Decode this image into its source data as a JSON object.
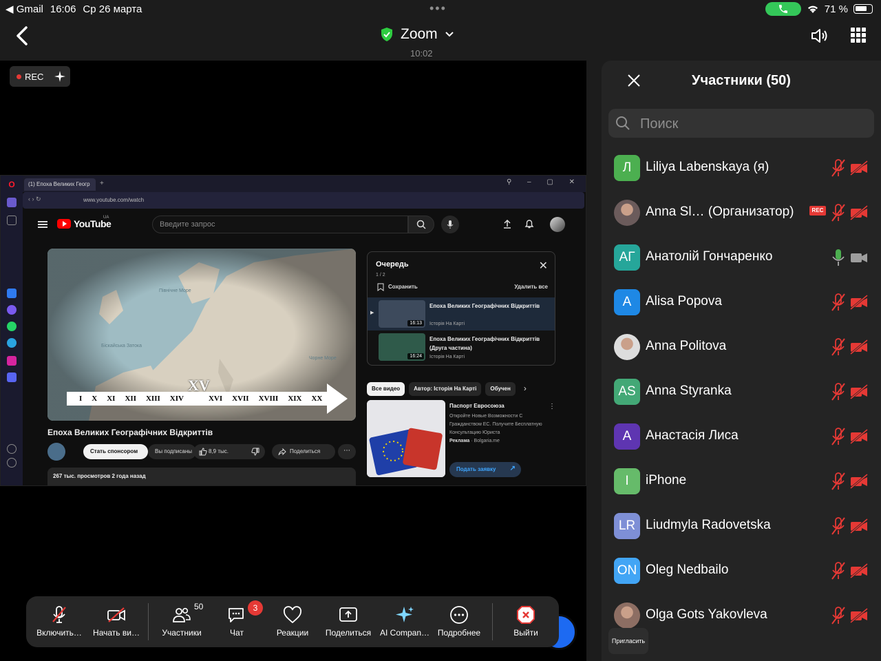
{
  "status_bar": {
    "back_app": "◀ Gmail",
    "time": "16:06",
    "date": "Ср 26 марта",
    "battery": "71 %",
    "colors": {
      "call": "#34c759"
    }
  },
  "header": {
    "title": "Zoom",
    "meeting_time": "10:02",
    "icons": [
      "chevron-left-icon",
      "shield-check-icon",
      "chevron-down-icon",
      "speaker-icon",
      "grid-icon"
    ]
  },
  "recording": {
    "label": "REC"
  },
  "shared_screen": {
    "tab_title": "(1) Епоха Великих Геогр",
    "url": "www.youtube.com/watch",
    "youtube": {
      "logo": "YouTube",
      "region": "UA",
      "search_placeholder": "Введите запрос",
      "video_title": "Епоха Великих Географічних Відкриттів",
      "sponsor_label": "Стать спонсором",
      "subscribed_label": "Вы подписаны",
      "likes": "8,9 тыс.",
      "share_label": "Поделиться",
      "views_info": "267 тыс. просмотров  2 года назад",
      "timeline_xv": "XV",
      "timeline_labels": [
        "I",
        "X",
        "XI",
        "XII",
        "XIII",
        "XIV",
        "XVI",
        "XVII",
        "XVIII",
        "XIX",
        "XX"
      ],
      "map_labels": {
        "north": "Північне Море",
        "biscay": "Біскайська Затока",
        "black": "Чорне Море"
      },
      "queue": {
        "title": "Очередь",
        "count": "1 / 2",
        "save": "Сохранить",
        "clear": "Удалить все",
        "items": [
          {
            "title": "Епоха Великих Географічних Відкриттів",
            "channel": "Історія На Карті",
            "duration": "16:13"
          },
          {
            "title": "Епоха Великих Географічних Відкриттів (Друга частина)",
            "channel": "Історія На Карті",
            "duration": "16:24"
          }
        ]
      },
      "chips": [
        "Все видео",
        "Автор: Історія На Карті",
        "Обучен"
      ],
      "ad": {
        "title": "Паспорт Евросоюза",
        "desc": "Откройте Новые Возможности С Гражданством ЕС. Получите Бесплатную Консультацию Юриста",
        "sponsor_prefix": "Реклама",
        "sponsor": "Bolgaria.me",
        "cta": "Подать заявку"
      }
    }
  },
  "toolbar": {
    "items": [
      {
        "label": "Включить…",
        "icon": "mic-off-icon"
      },
      {
        "label": "Начать ви…",
        "icon": "video-off-icon"
      },
      {
        "label": "Участники",
        "icon": "participants-icon",
        "count": "50"
      },
      {
        "label": "Чат",
        "icon": "chat-icon",
        "badge": "3"
      },
      {
        "label": "Реакции",
        "icon": "heart-icon"
      },
      {
        "label": "Поделиться",
        "icon": "share-screen-icon"
      },
      {
        "label": "AI Compan…",
        "icon": "sparkle-icon"
      },
      {
        "label": "Подробнее",
        "icon": "more-icon"
      },
      {
        "label": "Выйти",
        "icon": "leave-icon"
      }
    ]
  },
  "participants_panel": {
    "title": "Участники (50)",
    "search_placeholder": "Поиск",
    "invite_label": "Пригласить",
    "participants": [
      {
        "initials": "Л",
        "name": "Liliya Labenskaya  (я)",
        "color": "#4caf50",
        "mic": "muted",
        "cam": "off"
      },
      {
        "initials": "",
        "name": "Anna Sl…  (Организатор)",
        "color": "#6b5b5b",
        "photo": true,
        "rec": "REC",
        "mic": "muted",
        "cam": "off"
      },
      {
        "initials": "АГ",
        "name": "Анатолій Гончаренко",
        "color": "#26a69a",
        "mic": "on",
        "cam": "on"
      },
      {
        "initials": "A",
        "name": "Alisa Popova",
        "color": "#1e88e5",
        "mic": "muted",
        "cam": "off"
      },
      {
        "initials": "",
        "name": "Anna Politova",
        "color": "#ddd",
        "photo": true,
        "mic": "muted",
        "cam": "off"
      },
      {
        "initials": "AS",
        "name": "Anna Styranka",
        "color": "#43a876",
        "mic": "muted",
        "cam": "off"
      },
      {
        "initials": "А",
        "name": "Анастасія Лиса",
        "color": "#5e35b1",
        "mic": "muted",
        "cam": "off"
      },
      {
        "initials": "I",
        "name": "iPhone",
        "color": "#66bb6a",
        "mic": "muted",
        "cam": "off"
      },
      {
        "initials": "LR",
        "name": "Liudmyla Radovetska",
        "color": "#7e8fd6",
        "mic": "muted",
        "cam": "off"
      },
      {
        "initials": "ON",
        "name": "Oleg Nedbailo",
        "color": "#42a5f5",
        "mic": "muted",
        "cam": "off"
      },
      {
        "initials": "",
        "name": "Olga Gots Yakovleva",
        "color": "#8d6e63",
        "photo": true,
        "mic": "muted",
        "cam": "off"
      }
    ],
    "colors": {
      "muted": "#e53935",
      "active_mic": "#4caf50"
    }
  }
}
